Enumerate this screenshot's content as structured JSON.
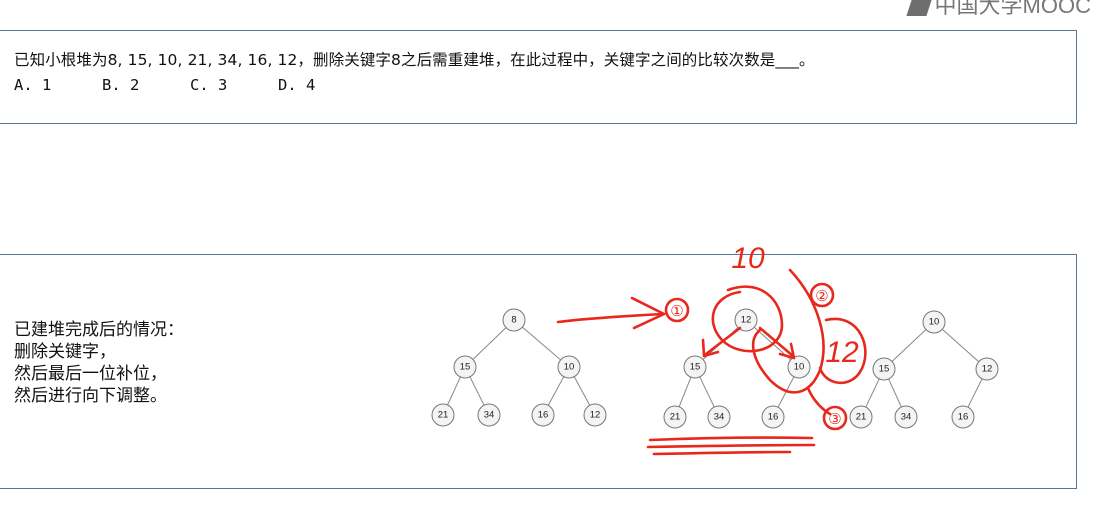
{
  "logo": {
    "text": "中国大学MOOC"
  },
  "question": {
    "text": "已知小根堆为8, 15, 10, 21, 34, 16, 12，删除关键字8之后需重建堆，在此过程中，关键字之间的比较次数是___。",
    "options": [
      "A. 1",
      "B. 2",
      "C. 3",
      "D. 4"
    ]
  },
  "explanation": {
    "lines": [
      "已建堆完成后的情况：",
      "删除关键字，",
      "然后最后一位补位，",
      "然后进行向下调整。"
    ]
  },
  "heaps": [
    {
      "nodes": [
        "8",
        "15",
        "10",
        "21",
        "34",
        "16",
        "12"
      ]
    },
    {
      "nodes": [
        "12",
        "15",
        "10",
        "21",
        "34",
        "16"
      ]
    },
    {
      "nodes": [
        "10",
        "15",
        "12",
        "21",
        "34",
        "16"
      ]
    }
  ],
  "annotations": [
    "①",
    "②",
    "③",
    "10",
    "12"
  ],
  "colors": {
    "border": "#5b7595",
    "ink": "#e8281c",
    "node_fill": "#f4f4f4"
  }
}
